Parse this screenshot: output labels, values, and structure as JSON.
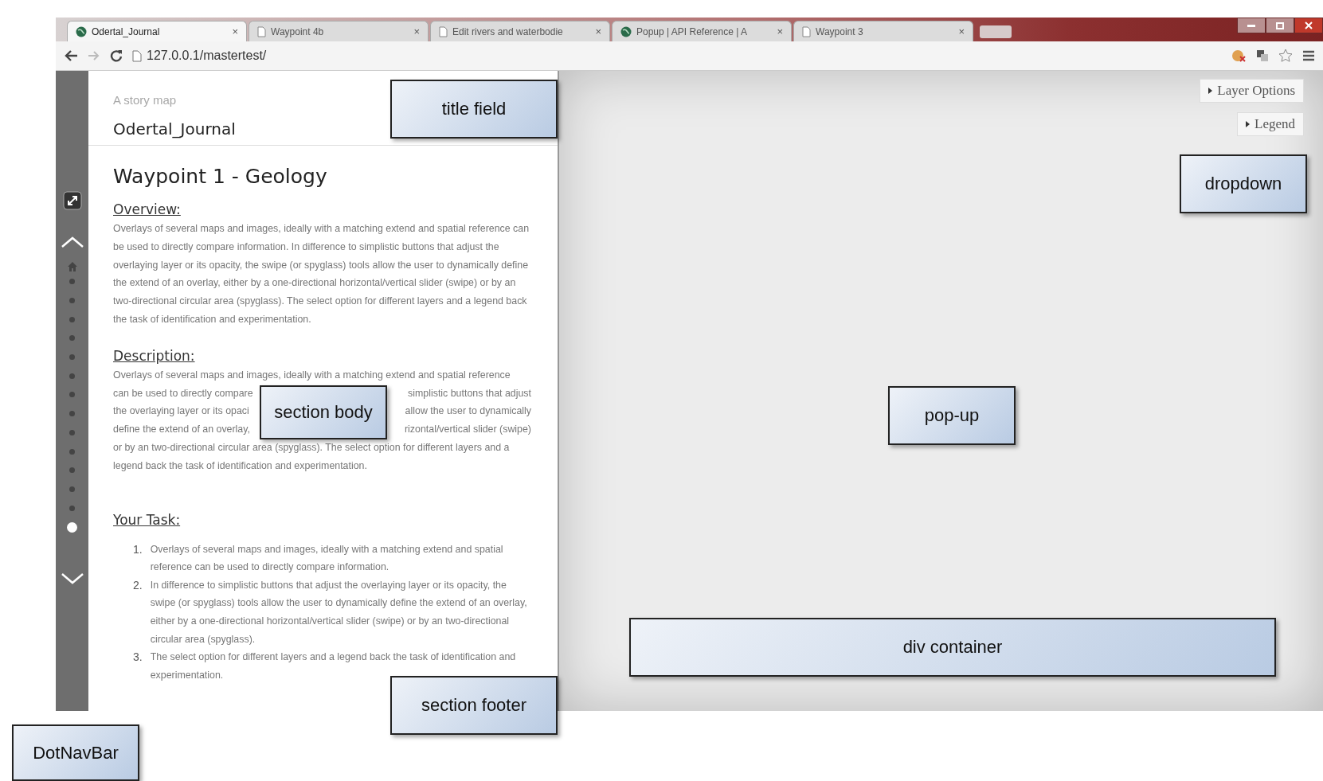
{
  "browser": {
    "tabs": [
      {
        "title": "Odertal_Journal",
        "kind": "site",
        "selected": true
      },
      {
        "title": "Waypoint 4b",
        "kind": "file",
        "selected": false
      },
      {
        "title": "Edit rivers and waterbodie",
        "kind": "file",
        "selected": false
      },
      {
        "title": "Popup | API Reference | A",
        "kind": "site",
        "selected": false
      },
      {
        "title": "Waypoint 3",
        "kind": "file",
        "selected": false
      }
    ],
    "close_mark": "×",
    "address": "127.0.0.1/mastertest/"
  },
  "dot_nav": {
    "dots": [
      {
        "selected": false
      },
      {
        "selected": false
      },
      {
        "selected": false
      },
      {
        "selected": false
      },
      {
        "selected": false
      },
      {
        "selected": false
      },
      {
        "selected": false
      },
      {
        "selected": false
      },
      {
        "selected": false
      },
      {
        "selected": false
      },
      {
        "selected": false
      },
      {
        "selected": false
      },
      {
        "selected": false
      },
      {
        "selected": true
      }
    ]
  },
  "panel": {
    "subtitle": "A story map",
    "title": "Odertal_Journal",
    "heading": "Waypoint 1 - Geology",
    "sections": [
      {
        "kind": "paragraph",
        "heading": "Overview:",
        "text": "Overlays of several maps and images, ideally with a matching extend and spatial reference can be used to directly compare information. In difference to simplistic buttons that adjust the overlaying layer or its opacity, the swipe (or spyglass) tools allow the user to dynamically define the extend of an overlay, either by a one-directional horizontal/vertical slider (swipe) or by an two-directional circular area (spyglass). The select option for different layers and a legend back the task of identification and experimentation."
      },
      {
        "kind": "lines",
        "heading": "Description:",
        "lines": [
          {
            "parts": [
              "Overlays of several maps and images, ideally with a matching extend and spatial reference"
            ]
          },
          {
            "parts": [
              "can be used to directly compare",
              "simplistic buttons that adjust"
            ]
          },
          {
            "parts": [
              "the overlaying layer or its opaci",
              "allow the user to dynamically"
            ]
          },
          {
            "parts": [
              "define the extend of an overlay,",
              "rizontal/vertical slider (swipe)"
            ]
          },
          {
            "parts": [
              "or by an two-directional circular area (spyglass). The select option for different layers and a"
            ]
          },
          {
            "parts": [
              "legend back the task of identification and experimentation."
            ]
          }
        ]
      },
      {
        "kind": "list",
        "heading": "Your Task:",
        "items": [
          {
            "number": "1.",
            "text": "Overlays of several maps and images, ideally with a matching extend and spatial reference can be used to directly compare information."
          },
          {
            "number": "2.",
            "text": "In difference to simplistic buttons that adjust the overlaying layer or its opacity, the swipe (or spyglass) tools allow the user to dynamically define the extend of an overlay, either by a one-directional horizontal/vertical slider (swipe) or by an two-directional circular area (spyglass)."
          },
          {
            "number": "3.",
            "text": "The select option for different layers and a legend back the task of identification and experimentation."
          }
        ]
      }
    ]
  },
  "map": {
    "buttons": [
      "Layer Options",
      "Legend"
    ]
  },
  "callouts": [
    {
      "label": "title field"
    },
    {
      "label": "dropdown"
    },
    {
      "label": "section body"
    },
    {
      "label": "pop-up"
    },
    {
      "label": "div container"
    },
    {
      "label": "section footer"
    },
    {
      "label": "DotNavBar"
    }
  ]
}
